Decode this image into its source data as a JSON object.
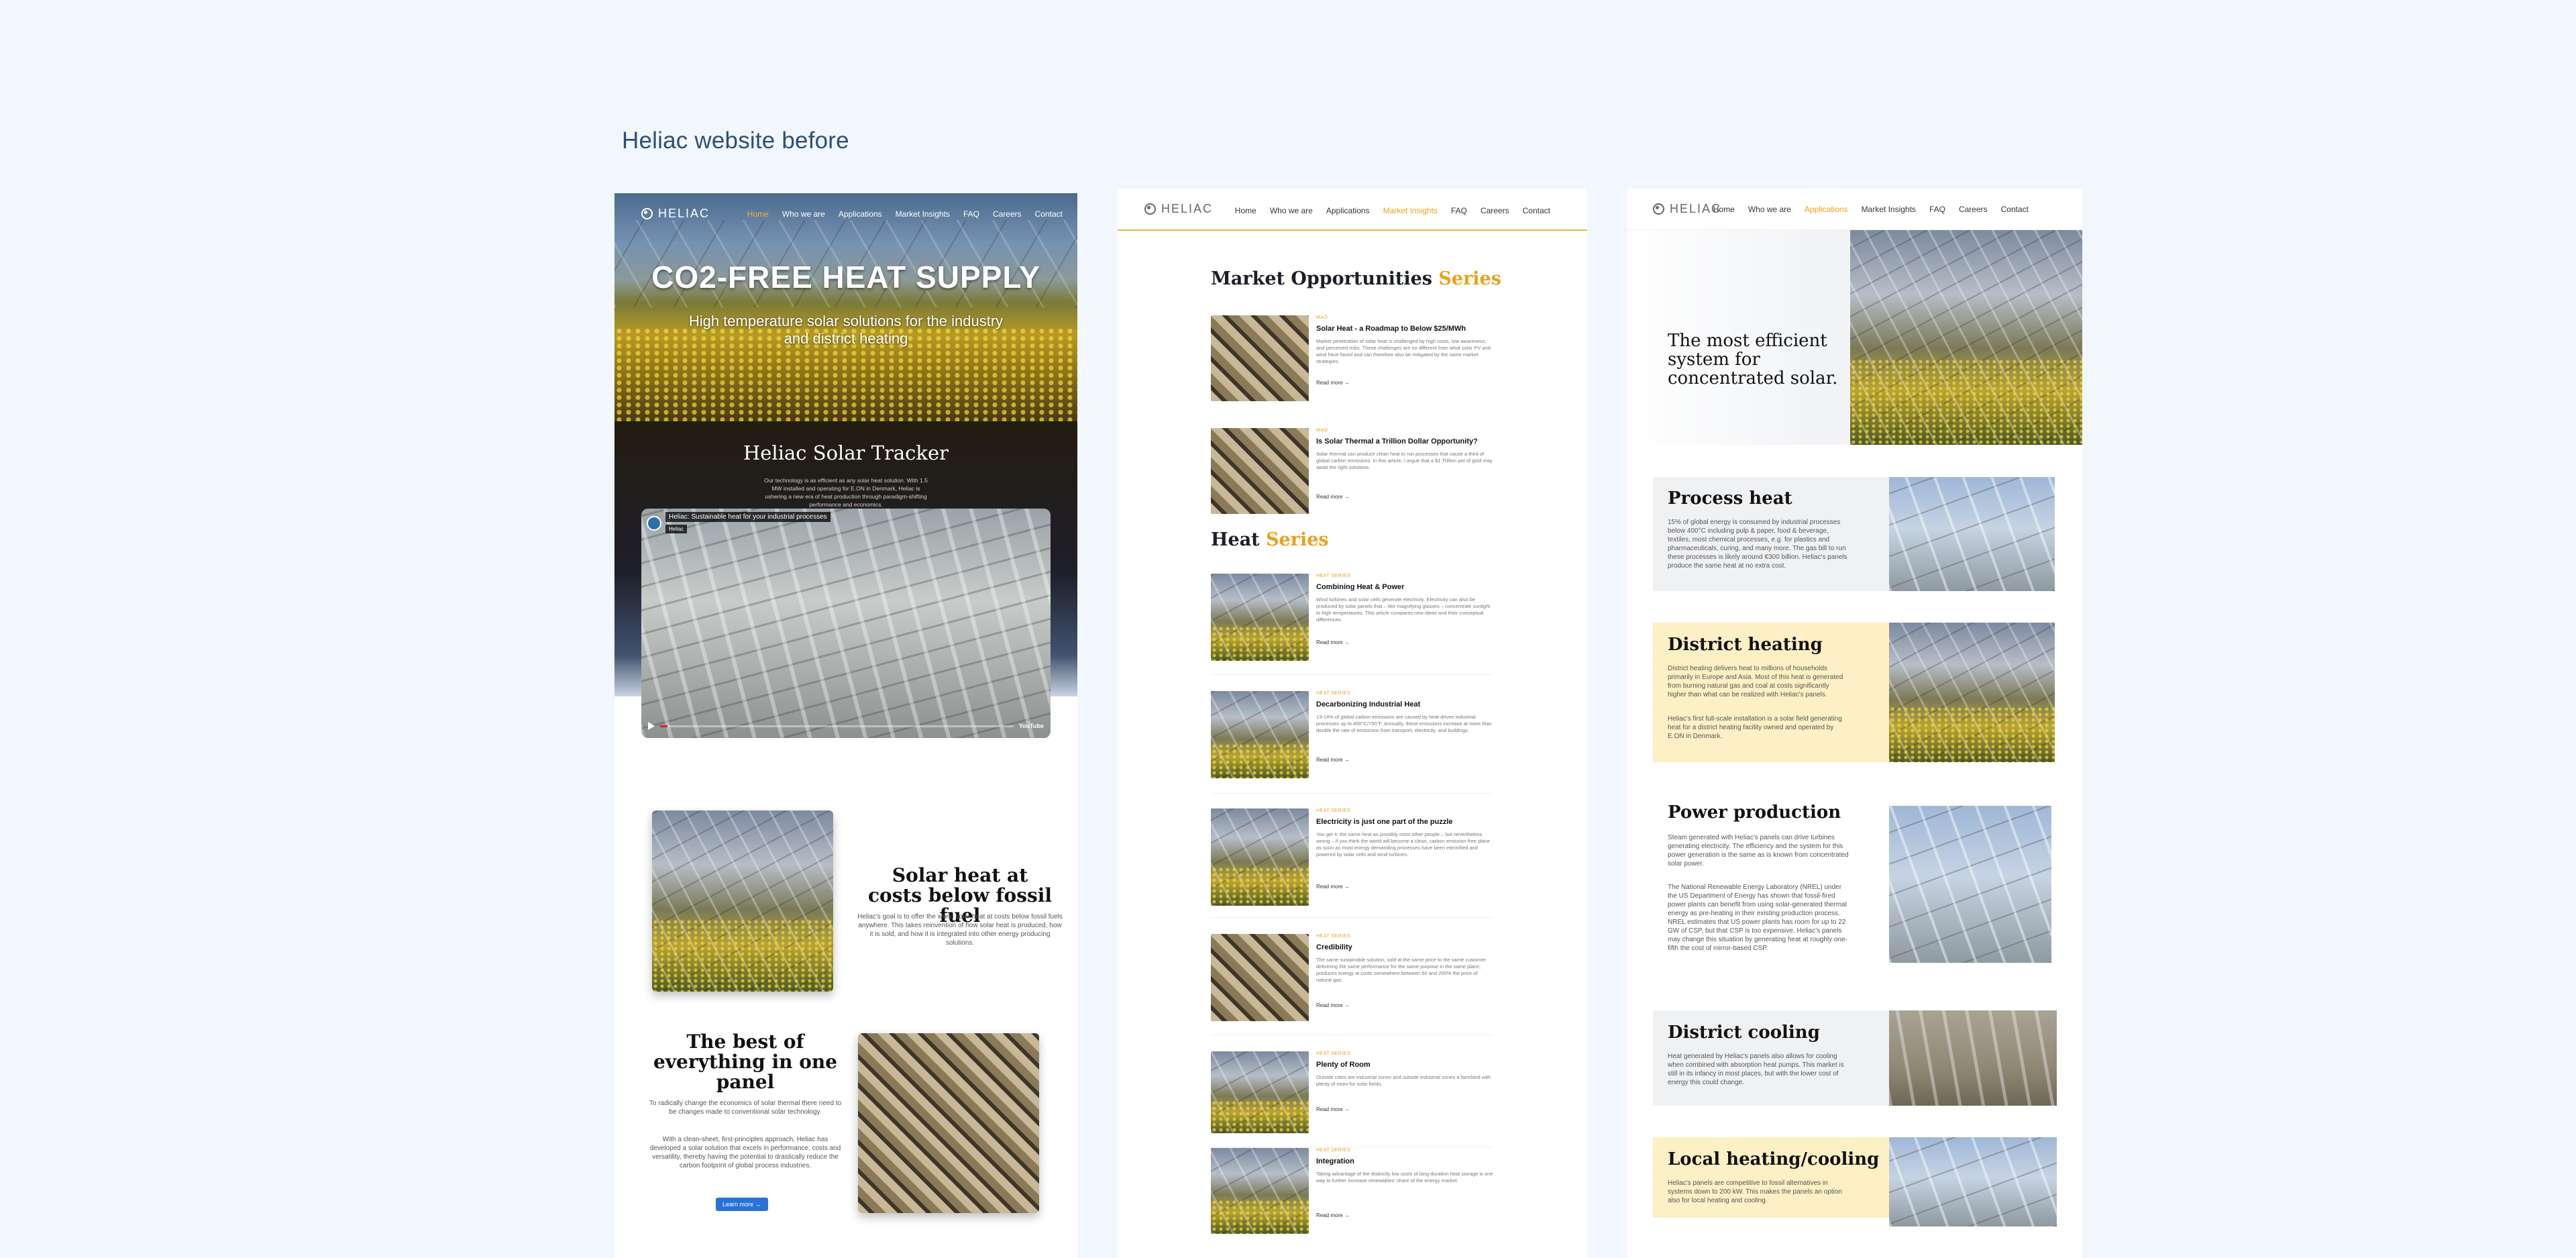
{
  "page_heading": "Heliac website before",
  "brand": "HELIAC",
  "nav": [
    "Home",
    "Who we are",
    "Applications",
    "Market Insights",
    "FAQ",
    "Careers",
    "Contact"
  ],
  "colors": {
    "accent": "#e8a21c",
    "link_blue": "#2b72d6",
    "heading_blue": "#2d4f73",
    "district_bg": "#fdf0c4",
    "gray_bg": "#f0f1f3"
  },
  "panel1": {
    "active_nav": "Home",
    "hero_title": "CO2-FREE HEAT SUPPLY",
    "hero_subtitle": "High temperature solar solutions for the industry and district heating",
    "tracker_title": "Heliac Solar Tracker",
    "tracker_body": "Our technology is as efficient as any solar heat solution. With 1.5 MW installed and operating for E.ON in Denmark, Heliac is ushering a new era of heat production through paradigm-shifting performance and economics.",
    "video_title": "Heliac: Sustainable heat for your industrial processes",
    "video_channel": "Heliac",
    "video_platform": "YouTube",
    "section2_title": "Solar heat at costs below fossil fuel",
    "section2_body": "Heliac's goal is to offer the world solar heat at costs below fossil fuels anywhere. This takes reinvention of how solar heat is produced, how it is sold, and how it is integrated into other energy producing solutions.",
    "section3_title": "The best of everything in one panel",
    "section3_body1": "To radically change the economics of solar thermal there need to be changes made to conventional solar technology.",
    "section3_body2": "With a clean-sheet, first-principles approach, Heliac has developed a solar solution that excels in performance, costs and versatility, thereby having the potential to drastically reduce the carbon footprint of global process industries.",
    "learn_more": "Learn more →"
  },
  "panel2": {
    "active_nav": "Market Insights",
    "series1_title": "Market Opportunities",
    "series_word": "Series",
    "series2_title": "Heat",
    "articles": [
      {
        "tag": "MAO",
        "title": "Solar Heat - a Roadmap to Below $25/MWh",
        "excerpt": "Market penetration of solar heat is challenged by high costs, low awareness, and perceived risks. These challenges are no different from what solar PV and wind have faced and can therefore also be mitigated by the same market strategies.",
        "more": "Read more →"
      },
      {
        "tag": "MAO",
        "title": "Is Solar Thermal a Trillion Dollar Opportunity?",
        "excerpt": "Solar thermal can produce clean heat to run processes that cause a third of global carbon emissions. In this article, I argue that a $1 Trillion pot of gold may await the right solutions.",
        "more": "Read more →"
      },
      {
        "tag": "HEAT SERIES",
        "title": "Combining Heat & Power",
        "excerpt": "Wind turbines and solar cells generate electricity. Electricity can also be produced by solar panels that – like magnifying glasses – concentrate sunlight to high temperatures. This article compares new ideas and their conceptual differences.",
        "more": "Read more →"
      },
      {
        "tag": "HEAT SERIES",
        "title": "Decarbonizing Industrial Heat",
        "excerpt": "13-14% of global carbon emissions are caused by heat-driven industrial processes up to 400°C/750°F. Annually, these emissions increase at more than double the rate of emissions from transport, electricity, and buildings.",
        "more": "Read more →"
      },
      {
        "tag": "HEAT SERIES",
        "title": "Electricity is just one part of the puzzle",
        "excerpt": "You get it: the same heat as possibly most other people – but nevertheless wrong – if you think the world will become a clean, carbon emission-free place as soon as most energy demanding processes have been electrified and powered by solar cells and wind turbines.",
        "more": "Read more →"
      },
      {
        "tag": "HEAT SERIES",
        "title": "Credibility",
        "excerpt": "The same sustainable solution, sold at the same price to the same customer delivering the same performance for the same purpose in the same place, produces energy at costs somewhere between 50 and 200% the price of natural gas.",
        "more": "Read more →"
      },
      {
        "tag": "HEAT SERIES",
        "title": "Plenty of Room",
        "excerpt": "Outside cities are industrial zones and outside industrial zones a farmland with plenty of room for solar fields.",
        "more": "Read more →"
      },
      {
        "tag": "HEAT SERIES",
        "title": "Integration",
        "excerpt": "Taking advantage of the distinctly low costs of long-duration heat storage is one way to further increase renewables' share of the energy market.",
        "more": "Read more →"
      }
    ]
  },
  "panel3": {
    "active_nav": "Applications",
    "hero_title": "The most efficient system for concentrated solar.",
    "blocks": [
      {
        "title": "Process heat",
        "body": "15% of global energy is consumed by industrial processes below 400°C including pulp & paper, food & beverage, textiles, most chemical processes, e.g. for plastics and pharmaceuticals, curing, and many more. The gas bill to run these processes is likely around €300 billion. Heliac's panels produce the same heat at no extra cost."
      },
      {
        "title": "District heating",
        "body": "District heating delivers heat to millions of households primarily in Europe and Asia. Most of this heat is generated from burning natural gas and coal at costs significantly higher than what can be realized with Heliac's panels.",
        "body2": "Heliac's first full-scale installation is a solar field generating heat for a district heating facility owned and operated by E.ON in Denmark."
      },
      {
        "title": "Power production",
        "body": "Steam generated with Heliac's panels can drive turbines generating electricity. The efficiency and the system for this power generation is the same as is known from concentrated solar power.",
        "body2": "The National Renewable Energy Laboratory (NREL) under the US Department of Energy has shown that fossil-fired power plants can benefit from using solar-generated thermal energy as pre-heating in their existing production process. NREL estimates that US power plants has room for up to 22 GW of CSP, but that CSP is too expensive. Heliac's panels may change this situation by generating heat at roughly one-fifth the cost of mirror-based CSP."
      },
      {
        "title": "District cooling",
        "body": "Heat generated by Heliac's panels also allows for cooling when combined with absorption heat pumps. This market is still in its infancy in most places, but with the lower cost of energy this could change."
      },
      {
        "title": "Local heating/cooling",
        "body": "Heliac's panels are competitive to fossil alternatives in systems down to 200 kW. This makes the panels an option also for local heating and cooling."
      }
    ]
  }
}
